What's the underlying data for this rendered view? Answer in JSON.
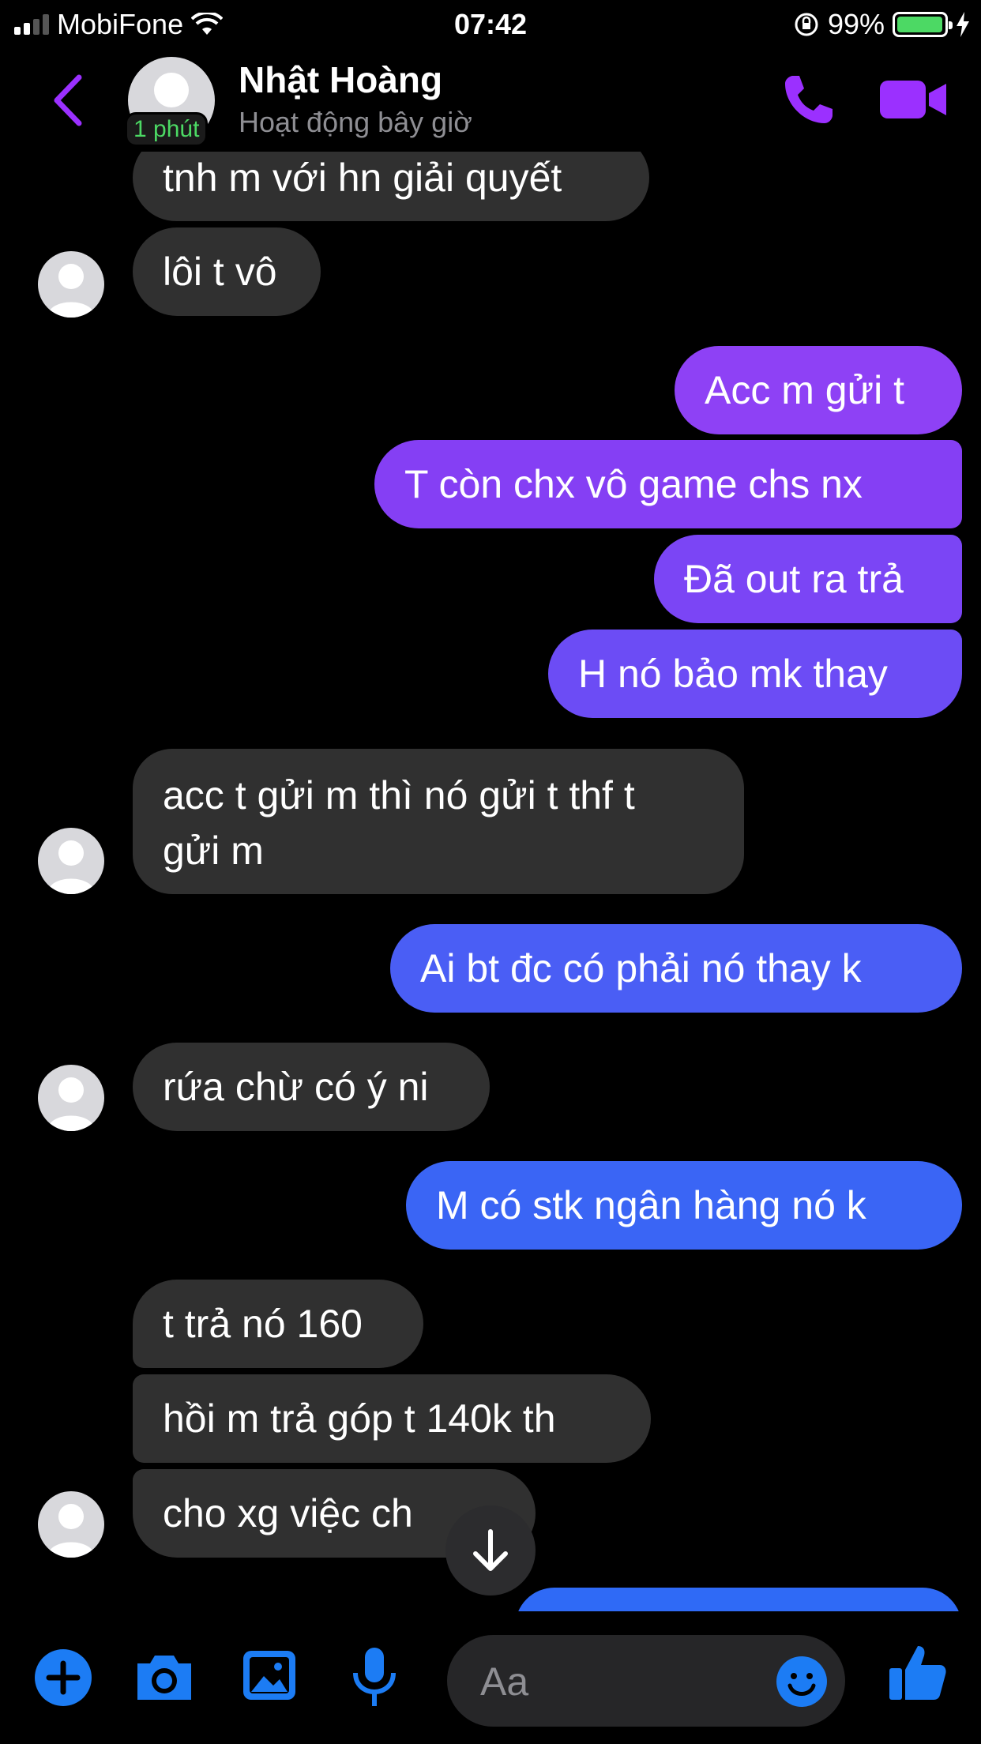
{
  "status_bar": {
    "carrier": "MobiFone",
    "time": "07:42",
    "battery": "99%",
    "battery_level": 0.99
  },
  "header": {
    "name": "Nhật Hoàng",
    "status": "Hoạt động bây giờ",
    "online_badge": "1 phút",
    "accent_color": "#9b30ff"
  },
  "messages": [
    {
      "side": "in",
      "text": "tnh m với hn giải quyết"
    },
    {
      "side": "in",
      "text": "lôi t vô"
    },
    {
      "side": "out",
      "text": "Acc m gửi t"
    },
    {
      "side": "out",
      "text": "T còn chx vô game chs nx"
    },
    {
      "side": "out",
      "text": "Đã out ra trả"
    },
    {
      "side": "out",
      "text": "H nó bảo mk thay"
    },
    {
      "side": "in",
      "text": "acc t gửi m thì nó gửi t thf t",
      "text2": "gửi m"
    },
    {
      "side": "out",
      "text": "Ai bt đc có phải nó thay k"
    },
    {
      "side": "in",
      "text": "rứa chừ có ý ni"
    },
    {
      "side": "out",
      "text": "M có stk ngân hàng nó k"
    },
    {
      "side": "in",
      "text": "t trả nó 160"
    },
    {
      "side": "in",
      "text": "hồi m trả góp t 140k th"
    },
    {
      "side": "in",
      "text": "cho xg việc ch"
    }
  ],
  "composer": {
    "placeholder": "Aa"
  },
  "colors": {
    "incoming_bubble": "#303030",
    "outgoing_gradient_top": "#9b3ff5",
    "outgoing_gradient_bottom": "#2f6af6",
    "icon_blue": "#1c7cf4"
  }
}
